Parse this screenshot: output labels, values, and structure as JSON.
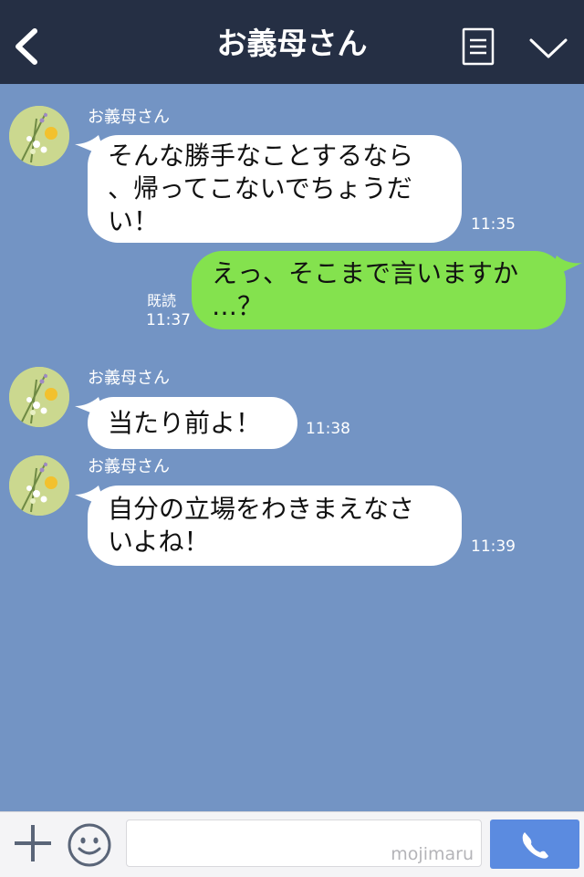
{
  "header": {
    "title": "お義母さん",
    "back_icon": "chevron-left-icon",
    "menu_icon": "notes-icon",
    "more_icon": "chevron-down-icon",
    "background": "#252f44"
  },
  "chat": {
    "background": "#7394c4",
    "messages": [
      {
        "sender": "お義母さん",
        "direction": "incoming",
        "lines": [
          "そんな勝手なことするなら",
          "、帰ってこないでちょうだ",
          "い！"
        ],
        "time": "11:35"
      },
      {
        "direction": "outgoing",
        "lines": [
          "えっ、そこまで言いますか",
          "…？"
        ],
        "read_label": "既読",
        "time": "11:37"
      },
      {
        "sender": "お義母さん",
        "direction": "incoming",
        "lines": [
          "当たり前よ！"
        ],
        "time": "11:38"
      },
      {
        "sender": "お義母さん",
        "direction": "incoming",
        "lines": [
          "自分の立場をわきまえなさ",
          "いよね！"
        ],
        "time": "11:39"
      }
    ],
    "incoming_bubble_color": "#ffffff",
    "outgoing_bubble_color": "#84e24e"
  },
  "footer": {
    "plus_icon": "plus-icon",
    "emoji_icon": "smiley-icon",
    "input_value": "",
    "watermark": "mojimaru",
    "call_icon": "phone-icon",
    "call_color": "#5b8be0"
  }
}
